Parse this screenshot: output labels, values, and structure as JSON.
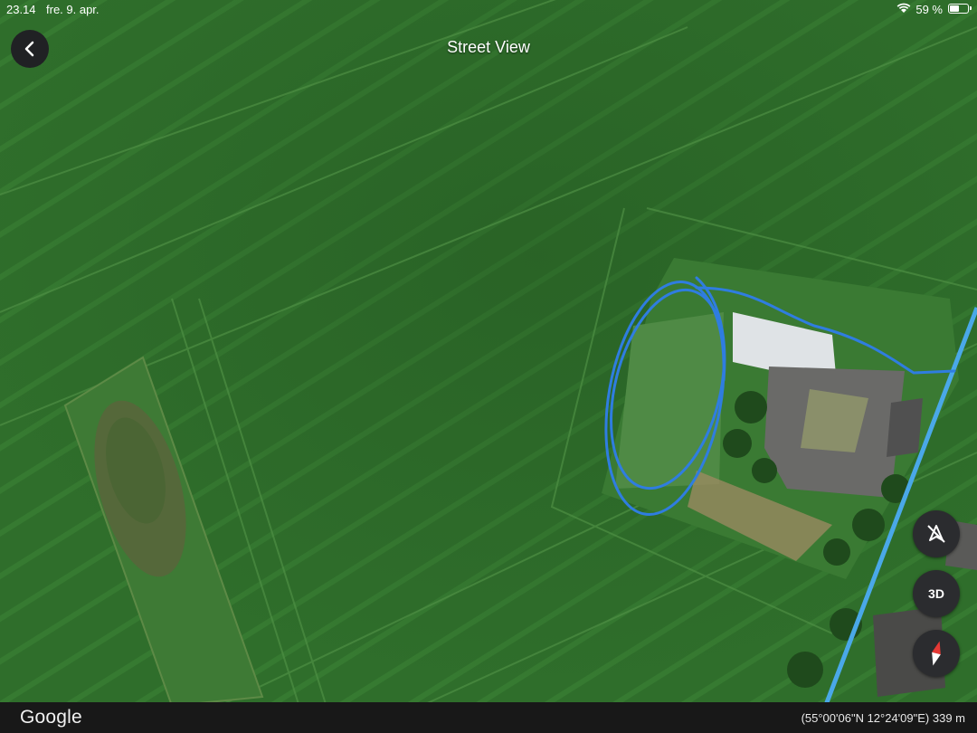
{
  "status_bar": {
    "time": "23.14",
    "date": "fre. 9. apr.",
    "battery_percent": "59 %",
    "battery_level": 0.59,
    "wifi_icon": "wifi-icon"
  },
  "header": {
    "title": "Street View",
    "back_icon": "chevron-left-icon"
  },
  "controls": {
    "tilt_icon": "tilt-off-icon",
    "three_d_label": "3D",
    "compass_icon": "compass-icon"
  },
  "footer": {
    "logo": "Google",
    "coordinates": "(55°00'06\"N 12°24'09\"E) 339 m"
  },
  "colors": {
    "field": "#2f6f2c",
    "field_light": "#3d8136",
    "road_line": "#4aa8e8",
    "annotation": "#2f7de0",
    "control_bg": "#2b2c2f"
  }
}
